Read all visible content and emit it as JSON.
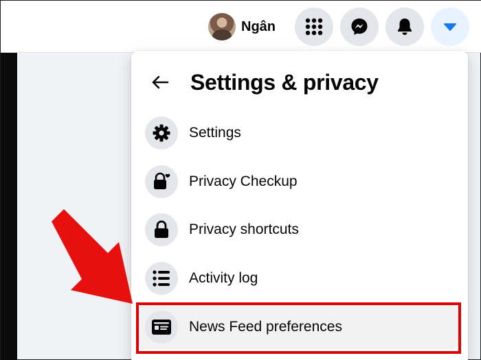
{
  "topbar": {
    "profile_name": "Ngân",
    "icons": {
      "menu": "grid-menu-icon",
      "messenger": "messenger-icon",
      "notifications": "bell-icon",
      "account": "caret-down-icon"
    }
  },
  "settings_menu": {
    "title": "Settings & privacy",
    "back_icon": "arrow-left-icon",
    "items": [
      {
        "label": "Settings",
        "icon": "gear-icon"
      },
      {
        "label": "Privacy Checkup",
        "icon": "lock-heart-icon"
      },
      {
        "label": "Privacy shortcuts",
        "icon": "lock-icon"
      },
      {
        "label": "Activity log",
        "icon": "list-icon"
      },
      {
        "label": "News Feed preferences",
        "icon": "news-feed-icon",
        "highlighted": true
      }
    ]
  },
  "colors": {
    "highlight_box": "#e00000",
    "annotation_arrow": "#e8100f",
    "accent": "#1877f2"
  }
}
